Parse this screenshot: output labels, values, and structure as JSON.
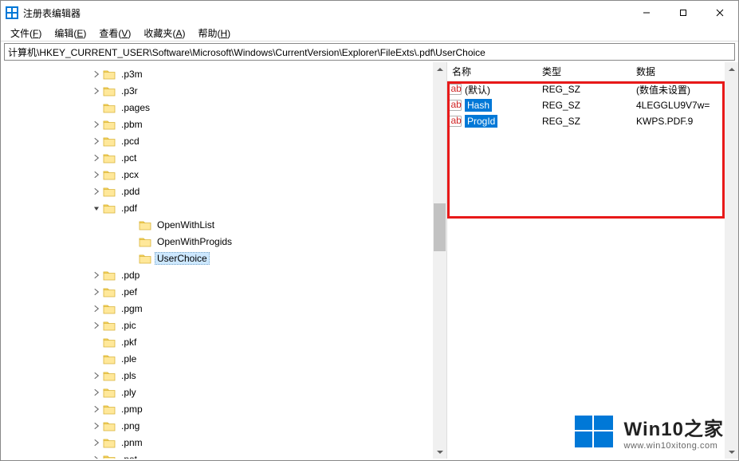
{
  "window": {
    "title": "注册表编辑器"
  },
  "menu": {
    "file": {
      "label": "文件",
      "accel": "F"
    },
    "edit": {
      "label": "编辑",
      "accel": "E"
    },
    "view": {
      "label": "查看",
      "accel": "V"
    },
    "fav": {
      "label": "收藏夹",
      "accel": "A"
    },
    "help": {
      "label": "帮助",
      "accel": "H"
    }
  },
  "address": "计算机\\HKEY_CURRENT_USER\\Software\\Microsoft\\Windows\\CurrentVersion\\Explorer\\FileExts\\.pdf\\UserChoice",
  "tree": {
    "items": [
      {
        "name": ".p3m",
        "exp": "right"
      },
      {
        "name": ".p3r",
        "exp": "right"
      },
      {
        "name": ".pages",
        "exp": "none"
      },
      {
        "name": ".pbm",
        "exp": "right"
      },
      {
        "name": ".pcd",
        "exp": "right"
      },
      {
        "name": ".pct",
        "exp": "right"
      },
      {
        "name": ".pcx",
        "exp": "right"
      },
      {
        "name": ".pdd",
        "exp": "right"
      },
      {
        "name": ".pdf",
        "exp": "down",
        "children": [
          {
            "name": "OpenWithList"
          },
          {
            "name": "OpenWithProgids"
          },
          {
            "name": "UserChoice",
            "selected": true
          }
        ]
      },
      {
        "name": ".pdp",
        "exp": "right"
      },
      {
        "name": ".pef",
        "exp": "right"
      },
      {
        "name": ".pgm",
        "exp": "right"
      },
      {
        "name": ".pic",
        "exp": "right"
      },
      {
        "name": ".pkf",
        "exp": "none"
      },
      {
        "name": ".ple",
        "exp": "none"
      },
      {
        "name": ".pls",
        "exp": "right"
      },
      {
        "name": ".ply",
        "exp": "right"
      },
      {
        "name": ".pmp",
        "exp": "right"
      },
      {
        "name": ".png",
        "exp": "right"
      },
      {
        "name": ".pnm",
        "exp": "right"
      },
      {
        "name": ".pot",
        "exp": "right"
      }
    ]
  },
  "list": {
    "columns": {
      "name": "名称",
      "type": "类型",
      "data": "数据"
    },
    "rows": [
      {
        "name": "(默认)",
        "type": "REG_SZ",
        "data": "(数值未设置)",
        "sel": false
      },
      {
        "name": "Hash",
        "type": "REG_SZ",
        "data": "4LEGGLU9V7w=",
        "sel": true
      },
      {
        "name": "ProgId",
        "type": "REG_SZ",
        "data": "KWPS.PDF.9",
        "sel": true
      }
    ]
  },
  "watermark": {
    "big": "Win10之家",
    "small": "www.win10xitong.com"
  }
}
